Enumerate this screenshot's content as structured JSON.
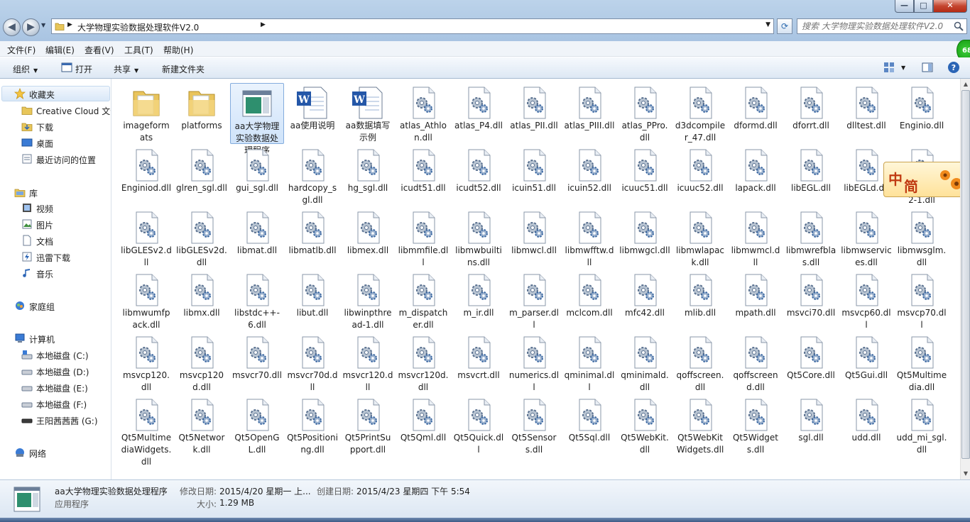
{
  "window": {
    "address_path": "大学物理实验数据处理软件V2.0",
    "search_placeholder": "搜索 大学物理实验数据处理软件V2.0"
  },
  "menu": [
    "文件(F)",
    "编辑(E)",
    "查看(V)",
    "工具(T)",
    "帮助(H)"
  ],
  "toolbar": {
    "organize": "组织",
    "open": "打开",
    "share": "共享",
    "new_folder": "新建文件夹"
  },
  "tray_badge": "68",
  "nav": {
    "favorites": "收藏夹",
    "creative_cloud": "Creative Cloud 文件",
    "downloads": "下载",
    "desktop": "桌面",
    "recent": "最近访问的位置",
    "libraries": "库",
    "videos": "视频",
    "pictures": "图片",
    "documents": "文档",
    "thunder": "迅雷下载",
    "music": "音乐",
    "homegroup": "家庭组",
    "computer": "计算机",
    "drive_c": "本地磁盘 (C:)",
    "drive_d": "本地磁盘 (D:)",
    "drive_e": "本地磁盘 (E:)",
    "drive_f": "本地磁盘 (F:)",
    "drive_g": "王阳茜茜茜 (G:)",
    "network": "网络"
  },
  "ime": {
    "char1": "中",
    "char2": "简"
  },
  "files": [
    {
      "name": "imageformats",
      "type": "folder"
    },
    {
      "name": "platforms",
      "type": "folder"
    },
    {
      "name": "aa大学物理实验数据处理程序",
      "type": "app",
      "selected": true
    },
    {
      "name": "aa使用说明",
      "type": "doc"
    },
    {
      "name": "aa数据填写示例",
      "type": "doc"
    },
    {
      "name": "atlas_Athlon.dll",
      "type": "dll"
    },
    {
      "name": "atlas_P4.dll",
      "type": "dll"
    },
    {
      "name": "atlas_PII.dll",
      "type": "dll"
    },
    {
      "name": "atlas_PIII.dll",
      "type": "dll"
    },
    {
      "name": "atlas_PPro.dll",
      "type": "dll"
    },
    {
      "name": "d3dcompiler_47.dll",
      "type": "dll"
    },
    {
      "name": "dformd.dll",
      "type": "dll"
    },
    {
      "name": "dforrt.dll",
      "type": "dll"
    },
    {
      "name": "dlltest.dll",
      "type": "dll"
    },
    {
      "name": "Enginio.dll",
      "type": "dll"
    },
    {
      "name": "Enginiod.dll",
      "type": "dll"
    },
    {
      "name": "glren_sgl.dll",
      "type": "dll"
    },
    {
      "name": "gui_sgl.dll",
      "type": "dll"
    },
    {
      "name": "hardcopy_sgl.dll",
      "type": "dll"
    },
    {
      "name": "hg_sgl.dll",
      "type": "dll"
    },
    {
      "name": "icudt51.dll",
      "type": "dll"
    },
    {
      "name": "icudt52.dll",
      "type": "dll"
    },
    {
      "name": "icuin51.dll",
      "type": "dll"
    },
    {
      "name": "icuin52.dll",
      "type": "dll"
    },
    {
      "name": "icuuc51.dll",
      "type": "dll"
    },
    {
      "name": "icuuc52.dll",
      "type": "dll"
    },
    {
      "name": "lapack.dll",
      "type": "dll"
    },
    {
      "name": "libEGL.dll",
      "type": "dll"
    },
    {
      "name": "libEGLd.dll",
      "type": "dll"
    },
    {
      "name": "libgcc_s_dw2-1.dll",
      "type": "dll"
    },
    {
      "name": "libGLESv2.dll",
      "type": "dll"
    },
    {
      "name": "libGLESv2d.dll",
      "type": "dll"
    },
    {
      "name": "libmat.dll",
      "type": "dll"
    },
    {
      "name": "libmatlb.dll",
      "type": "dll"
    },
    {
      "name": "libmex.dll",
      "type": "dll"
    },
    {
      "name": "libmmfile.dll",
      "type": "dll"
    },
    {
      "name": "libmwbuiltins.dll",
      "type": "dll"
    },
    {
      "name": "libmwcl.dll",
      "type": "dll"
    },
    {
      "name": "libmwfftw.dll",
      "type": "dll"
    },
    {
      "name": "libmwgcl.dll",
      "type": "dll"
    },
    {
      "name": "libmwlapack.dll",
      "type": "dll"
    },
    {
      "name": "libmwmcl.dll",
      "type": "dll"
    },
    {
      "name": "libmwrefblas.dll",
      "type": "dll"
    },
    {
      "name": "libmwservices.dll",
      "type": "dll"
    },
    {
      "name": "libmwsglm.dll",
      "type": "dll"
    },
    {
      "name": "libmwumfpack.dll",
      "type": "dll"
    },
    {
      "name": "libmx.dll",
      "type": "dll"
    },
    {
      "name": "libstdc++-6.dll",
      "type": "dll"
    },
    {
      "name": "libut.dll",
      "type": "dll"
    },
    {
      "name": "libwinpthread-1.dll",
      "type": "dll"
    },
    {
      "name": "m_dispatcher.dll",
      "type": "dll"
    },
    {
      "name": "m_ir.dll",
      "type": "dll"
    },
    {
      "name": "m_parser.dll",
      "type": "dll"
    },
    {
      "name": "mclcom.dll",
      "type": "dll"
    },
    {
      "name": "mfc42.dll",
      "type": "dll"
    },
    {
      "name": "mlib.dll",
      "type": "dll"
    },
    {
      "name": "mpath.dll",
      "type": "dll"
    },
    {
      "name": "msvci70.dll",
      "type": "dll"
    },
    {
      "name": "msvcp60.dll",
      "type": "dll"
    },
    {
      "name": "msvcp70.dll",
      "type": "dll"
    },
    {
      "name": "msvcp120.dll",
      "type": "dll"
    },
    {
      "name": "msvcp120d.dll",
      "type": "dll"
    },
    {
      "name": "msvcr70.dll",
      "type": "dll"
    },
    {
      "name": "msvcr70d.dll",
      "type": "dll"
    },
    {
      "name": "msvcr120.dll",
      "type": "dll"
    },
    {
      "name": "msvcr120d.dll",
      "type": "dll"
    },
    {
      "name": "msvcrt.dll",
      "type": "dll"
    },
    {
      "name": "numerics.dll",
      "type": "dll"
    },
    {
      "name": "qminimal.dll",
      "type": "dll"
    },
    {
      "name": "qminimald.dll",
      "type": "dll"
    },
    {
      "name": "qoffscreen.dll",
      "type": "dll"
    },
    {
      "name": "qoffscreend.dll",
      "type": "dll"
    },
    {
      "name": "Qt5Core.dll",
      "type": "dll"
    },
    {
      "name": "Qt5Gui.dll",
      "type": "dll"
    },
    {
      "name": "Qt5Multimedia.dll",
      "type": "dll"
    },
    {
      "name": "Qt5MultimediaWidgets.dll",
      "type": "dll"
    },
    {
      "name": "Qt5Network.dll",
      "type": "dll"
    },
    {
      "name": "Qt5OpenGL.dll",
      "type": "dll"
    },
    {
      "name": "Qt5Positioning.dll",
      "type": "dll"
    },
    {
      "name": "Qt5PrintSupport.dll",
      "type": "dll"
    },
    {
      "name": "Qt5Qml.dll",
      "type": "dll"
    },
    {
      "name": "Qt5Quick.dll",
      "type": "dll"
    },
    {
      "name": "Qt5Sensors.dll",
      "type": "dll"
    },
    {
      "name": "Qt5Sql.dll",
      "type": "dll"
    },
    {
      "name": "Qt5WebKit.dll",
      "type": "dll"
    },
    {
      "name": "Qt5WebKitWidgets.dll",
      "type": "dll"
    },
    {
      "name": "Qt5Widgets.dll",
      "type": "dll"
    },
    {
      "name": "sgl.dll",
      "type": "dll"
    },
    {
      "name": "udd.dll",
      "type": "dll"
    },
    {
      "name": "udd_mi_sgl.dll",
      "type": "dll"
    }
  ],
  "details": {
    "name": "aa大学物理实验数据处理程序",
    "type": "应用程序",
    "modified_label": "修改日期:",
    "modified_value": "2015/4/20 星期一 上...",
    "created_label": "创建日期:",
    "created_value": "2015/4/23 星期四 下午 5:54",
    "size_label": "大小:",
    "size_value": "1.29 MB"
  }
}
